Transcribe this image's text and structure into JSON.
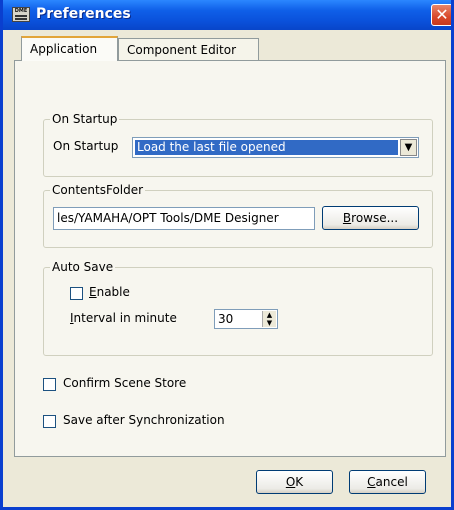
{
  "window": {
    "title": "Preferences",
    "icon_text": "DME"
  },
  "tabs": [
    {
      "label": "Application",
      "active": true
    },
    {
      "label": "Component Editor",
      "active": false
    }
  ],
  "startup": {
    "group_label": "On Startup",
    "field_label": "On Startup",
    "selected_option": "Load the last file opened"
  },
  "contents_folder": {
    "group_label": "ContentsFolder",
    "path_value": "les/YAMAHA/OPT Tools/DME Designer",
    "browse_mnemonic": "B",
    "browse_rest": "rowse..."
  },
  "auto_save": {
    "group_label": "Auto Save",
    "enable_mnemonic": "E",
    "enable_rest": "nable",
    "enable_checked": false,
    "interval_mnemonic": "I",
    "interval_rest": "nterval in minute",
    "interval_value": "30"
  },
  "options": {
    "confirm_scene_store": "Confirm Scene Store",
    "confirm_checked": false,
    "save_after_sync": "Save after Synchronization",
    "save_checked": false
  },
  "buttons": {
    "ok_mnemonic": "O",
    "ok_rest": "K",
    "cancel_mnemonic": "C",
    "cancel_rest": "ancel"
  },
  "colors": {
    "title_bar": "#0a51db",
    "selection": "#316ac5",
    "close_button": "#d9482a",
    "tab_highlight": "#e2a53a"
  }
}
